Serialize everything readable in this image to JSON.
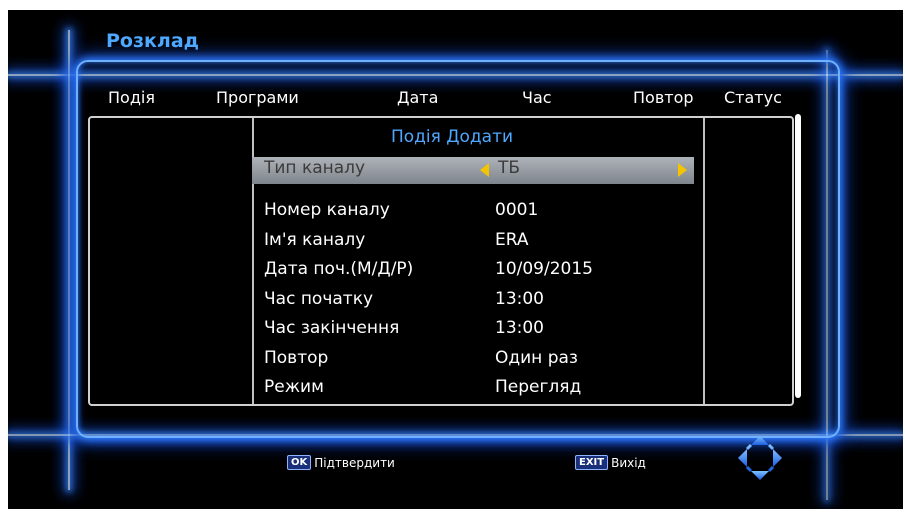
{
  "screen": {
    "title": "Розклад"
  },
  "columns": [
    "Подія",
    "Програми",
    "Дата",
    "Час",
    "Повтор",
    "Статус"
  ],
  "dialog": {
    "title": "Подія Додати",
    "rows": [
      {
        "label": "Тип каналу",
        "value": "ТБ"
      },
      {
        "label": "Номер каналу",
        "value": "0001"
      },
      {
        "label": "Ім'я каналу",
        "value": "ERA"
      },
      {
        "label": "Дата поч.(М/Д/Р)",
        "value": "10/09/2015"
      },
      {
        "label": "Час початку",
        "value": "13:00"
      },
      {
        "label": "Час закінчення",
        "value": "13:00"
      },
      {
        "label": "Повтор",
        "value": "Один раз"
      },
      {
        "label": "Режим",
        "value": "Перегляд"
      }
    ]
  },
  "footer": {
    "ok_key": "OK",
    "ok_label": "Підтвердити",
    "exit_key": "EXIT",
    "exit_label": "Вихід"
  },
  "icons": {
    "nav": "dpad-navigation-icon",
    "left_arrow": "triangle-left-icon",
    "right_arrow": "triangle-right-icon"
  },
  "colors": {
    "accent": "#4fa8ff",
    "glow": "#2f7dff",
    "highlight": "#9aa0a6",
    "arrow": "#f5c400"
  }
}
